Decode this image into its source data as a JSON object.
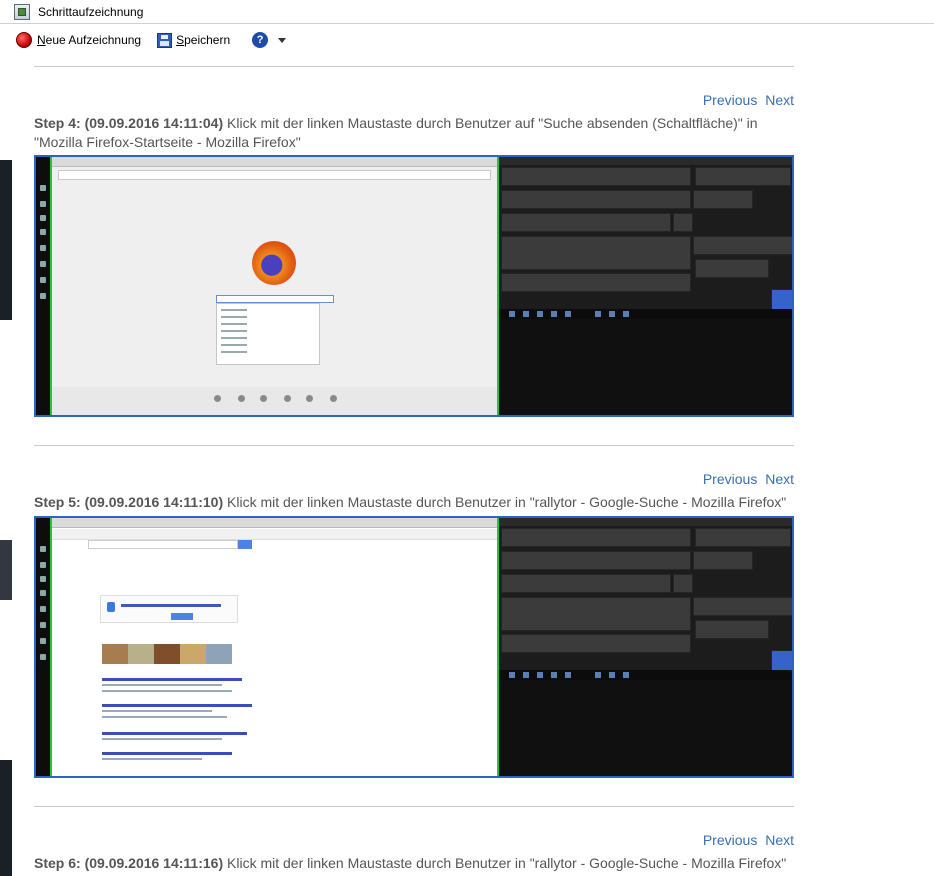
{
  "window": {
    "title": "Schrittaufzeichnung"
  },
  "toolbar": {
    "record_label": "Neue Aufzeichnung",
    "record_mnemonic": "N",
    "record_rest": "eue Aufzeichnung",
    "save_label": "Speichern",
    "save_mnemonic": "S",
    "save_rest": "peichern",
    "help_glyph": "?"
  },
  "nav": {
    "previous": "Previous",
    "next": "Next"
  },
  "steps": [
    {
      "heading": "Step 4: (09.09.2016 14:11:04)",
      "description": "Klick mit der linken Maustaste durch Benutzer auf \"Suche absenden (Schaltfläche)\" in \"Mozilla Firefox-Startseite - Mozilla Firefox\""
    },
    {
      "heading": "Step 5: (09.09.2016 14:11:10)",
      "description": "Klick mit der linken Maustaste durch Benutzer in \"rallytor - Google-Suche - Mozilla Firefox\""
    },
    {
      "heading": "Step 6: (09.09.2016 14:11:16)",
      "description": "Klick mit der linken Maustaste durch Benutzer in \"rallytor - Google-Suche - Mozilla Firefox\""
    }
  ],
  "colors": {
    "link": "#3a6fb0",
    "screenshot_border": "#2f62c6",
    "record": "#c40000",
    "help": "#1d4ca8"
  },
  "icons": [
    "app-icon",
    "record-icon",
    "save-icon",
    "help-icon",
    "chevron-down-icon"
  ]
}
